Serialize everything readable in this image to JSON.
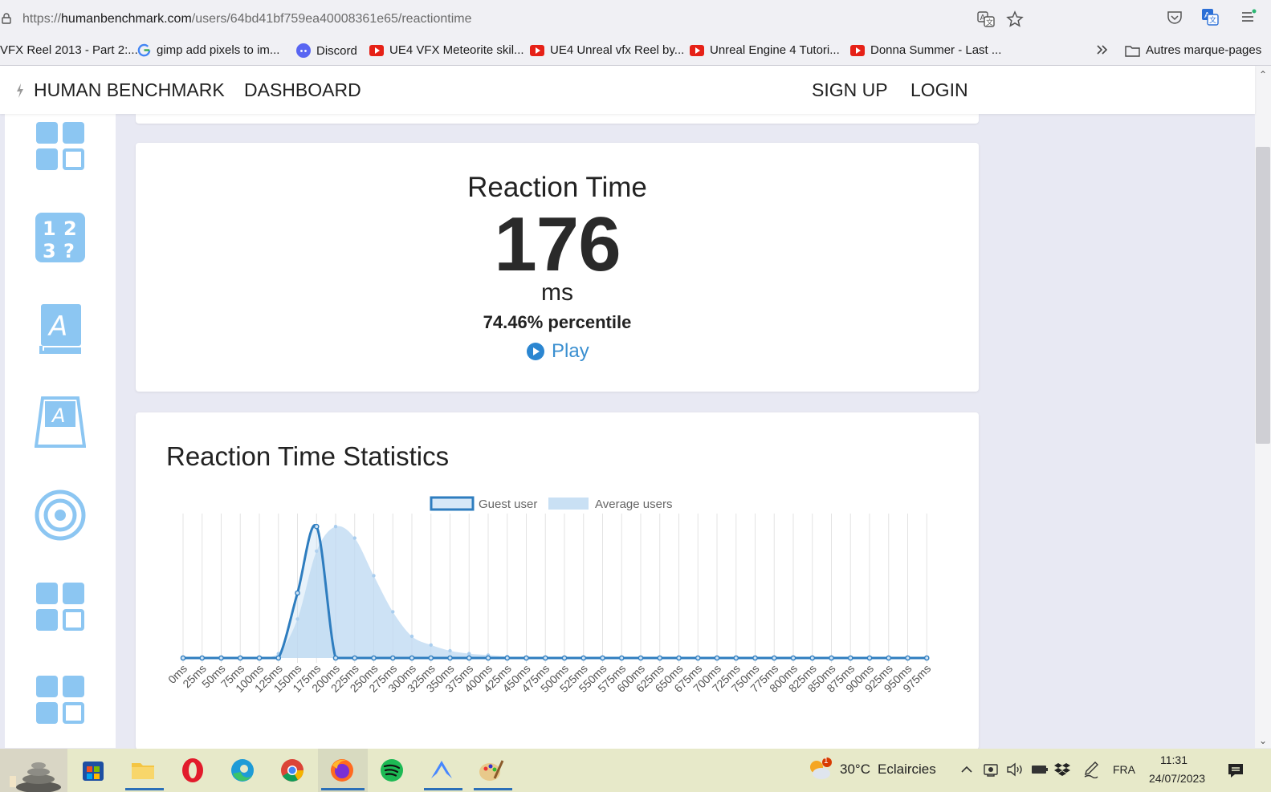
{
  "browser": {
    "url_prefix": "https://",
    "url_host": "humanbenchmark.com",
    "url_path": "/users/64bd41bf759ea40008361e65/reactiontime",
    "bookmarks": [
      {
        "label": "VFX Reel 2013 - Part 2:...",
        "icon": "bookmark-icon"
      },
      {
        "label": "gimp add pixels to im...",
        "icon": "google-icon"
      },
      {
        "label": "Discord",
        "icon": "discord-icon"
      },
      {
        "label": "UE4 VFX Meteorite skil...",
        "icon": "youtube-icon"
      },
      {
        "label": "UE4 Unreal vfx Reel by...",
        "icon": "youtube-icon"
      },
      {
        "label": "Unreal Engine 4 Tutori...",
        "icon": "youtube-icon"
      },
      {
        "label": "Donna Summer - Last ...",
        "icon": "youtube-icon"
      }
    ],
    "other_bookmarks": "Autres marque-pages"
  },
  "nav": {
    "brand": "HUMAN BENCHMARK",
    "dashboard": "DASHBOARD",
    "signup": "SIGN UP",
    "login": "LOGIN"
  },
  "sidebar": {
    "icons": [
      "grid-icon",
      "number-memory-icon",
      "verbal-memory-icon",
      "typing-icon",
      "aim-target-icon",
      "grid-icon",
      "grid-icon"
    ]
  },
  "reaction": {
    "title": "Reaction Time",
    "value": "176",
    "unit": "ms",
    "percentile": "74.46% percentile",
    "play_label": "Play"
  },
  "stats": {
    "title": "Reaction Time Statistics"
  },
  "chart_data": {
    "type": "area",
    "legend": [
      "Guest user",
      "Average users"
    ],
    "legend_position": "top-center",
    "x": [
      "0ms",
      "25ms",
      "50ms",
      "75ms",
      "100ms",
      "125ms",
      "150ms",
      "175ms",
      "200ms",
      "225ms",
      "250ms",
      "275ms",
      "300ms",
      "325ms",
      "350ms",
      "375ms",
      "400ms",
      "425ms",
      "450ms",
      "475ms",
      "500ms",
      "525ms",
      "550ms",
      "575ms",
      "600ms",
      "625ms",
      "650ms",
      "675ms",
      "700ms",
      "725ms",
      "750ms",
      "775ms",
      "800ms",
      "825ms",
      "850ms",
      "875ms",
      "900ms",
      "925ms",
      "950ms",
      "975ms"
    ],
    "series": [
      {
        "name": "Guest user",
        "values": [
          0,
          0,
          0,
          0,
          0,
          0,
          0.45,
          0.91,
          0,
          0,
          0,
          0,
          0,
          0,
          0,
          0,
          0,
          0,
          0,
          0,
          0,
          0,
          0,
          0,
          0,
          0,
          0,
          0,
          0,
          0,
          0,
          0,
          0,
          0,
          0,
          0,
          0,
          0,
          0,
          0
        ],
        "color": "#2e7dbf"
      },
      {
        "name": "Average users",
        "values": [
          0,
          0,
          0,
          0,
          0,
          0.03,
          0.27,
          0.74,
          0.91,
          0.83,
          0.57,
          0.32,
          0.15,
          0.09,
          0.05,
          0.03,
          0.02,
          0.01,
          0,
          0,
          0,
          0,
          0,
          0,
          0,
          0,
          0,
          0,
          0,
          0,
          0,
          0,
          0,
          0,
          0,
          0,
          0,
          0,
          0,
          0
        ],
        "color": "#bcd8f1"
      }
    ],
    "grid": true
  },
  "taskbar": {
    "weather_temp": "30°C",
    "weather_text": "Eclaircies",
    "weather_badge": "1",
    "language": "FRA",
    "time": "11:31",
    "date": "24/07/2023"
  }
}
